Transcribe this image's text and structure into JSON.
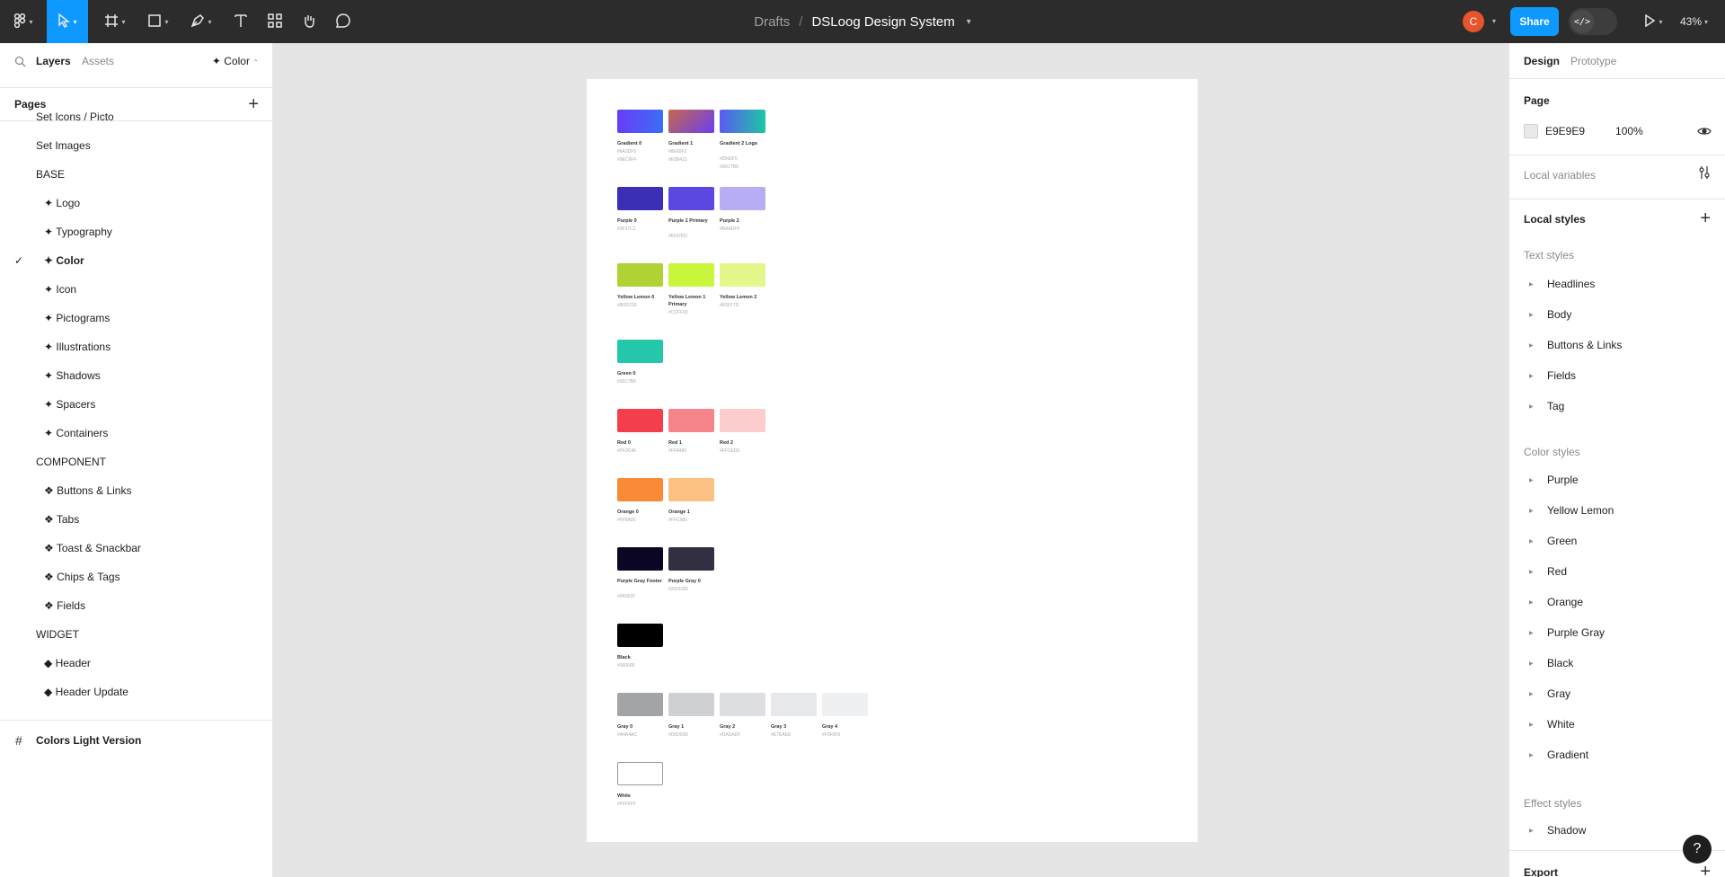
{
  "toolbar": {
    "file_drafts": "Drafts",
    "separator": "/",
    "file_name": "DSLoog Design System",
    "avatar_initial": "C",
    "share_label": "Share",
    "zoom": "43%"
  },
  "left_panel": {
    "tab_layers": "Layers",
    "tab_assets": "Assets",
    "page_selector": "✦ Color",
    "pages_title": "Pages",
    "pages_add": "+",
    "pages": [
      {
        "label": "Set Icons / Picto",
        "indent": 1,
        "current": false
      },
      {
        "label": "Set Images",
        "indent": 1,
        "current": false
      },
      {
        "label": "BASE",
        "indent": 1,
        "current": false
      },
      {
        "label": "✦ Logo",
        "indent": 2,
        "current": false
      },
      {
        "label": "✦ Typography",
        "indent": 2,
        "current": false
      },
      {
        "label": "✦ Color",
        "indent": 2,
        "current": true
      },
      {
        "label": "✦ Icon",
        "indent": 2,
        "current": false
      },
      {
        "label": "✦ Pictograms",
        "indent": 2,
        "current": false
      },
      {
        "label": "✦ Illustrations",
        "indent": 2,
        "current": false
      },
      {
        "label": "✦ Shadows",
        "indent": 2,
        "current": false
      },
      {
        "label": "✦ Spacers",
        "indent": 2,
        "current": false
      },
      {
        "label": "✦ Containers",
        "indent": 2,
        "current": false
      },
      {
        "label": "COMPONENT",
        "indent": 1,
        "current": false
      },
      {
        "label": "❖ Buttons & Links",
        "indent": 2,
        "current": false
      },
      {
        "label": "❖ Tabs",
        "indent": 2,
        "current": false
      },
      {
        "label": "❖ Toast & Snackbar",
        "indent": 2,
        "current": false
      },
      {
        "label": "❖ Chips & Tags",
        "indent": 2,
        "current": false
      },
      {
        "label": "❖ Fields",
        "indent": 2,
        "current": false
      },
      {
        "label": "WIDGET",
        "indent": 1,
        "current": false
      },
      {
        "label": "◆ Header",
        "indent": 2,
        "current": false
      },
      {
        "label": "◆ Header Update",
        "indent": 2,
        "current": false
      }
    ],
    "current_check": "✓",
    "frame_icon": "#",
    "frame_layer": "Colors Light Version"
  },
  "canvas": {
    "groups": [
      {
        "swatches": [
          {
            "name": "Gradient 0",
            "hex": "#6A3DF5\n#9EC6FF",
            "fill": "linear-gradient(90deg,#6a3df5,#3a6ef8)"
          },
          {
            "name": "Gradient 1",
            "hex": "#8E60F3\n#E5B423",
            "fill": "linear-gradient(135deg,#c7694a,#6a3df5)"
          },
          {
            "name": "Gradient 2 Logo",
            "hex": "#5560F5\n#00C7B6",
            "fill": "linear-gradient(90deg,#5b5af0,#1ec6a6)"
          }
        ]
      },
      {
        "swatches": [
          {
            "name": "Purple 0",
            "hex": "#3F37C1",
            "fill": "#3b2fb5"
          },
          {
            "name": "Purple 1 Primary",
            "hex": "#6167ED",
            "fill": "#5a48e0"
          },
          {
            "name": "Purple 2",
            "hex": "#BAADFF",
            "fill": "#b6adf5"
          }
        ]
      },
      {
        "swatches": [
          {
            "name": "Yellow Lemon 0",
            "hex": "#B0DC00",
            "fill": "#afd234"
          },
          {
            "name": "Yellow Lemon 1 Primary",
            "hex": "#CCFF00",
            "fill": "#c9f53c"
          },
          {
            "name": "Yellow Lemon 2",
            "hex": "#E5FF7D",
            "fill": "#e3f78a"
          }
        ]
      },
      {
        "swatches": [
          {
            "name": "Green 0",
            "hex": "#00C7B6",
            "fill": "#24c7aa"
          }
        ]
      },
      {
        "swatches": [
          {
            "name": "Red 0",
            "hex": "#FF3C46",
            "fill": "#f53e4c"
          },
          {
            "name": "Red 1",
            "hex": "#FF8489",
            "fill": "#f5838a"
          },
          {
            "name": "Red 2",
            "hex": "#FFCED0",
            "fill": "#fdcccd"
          }
        ]
      },
      {
        "swatches": [
          {
            "name": "Orange 0",
            "hex": "#FF8A00",
            "fill": "#fb8a36"
          },
          {
            "name": "Orange 1",
            "hex": "#FFC680",
            "fill": "#fcc182"
          }
        ]
      },
      {
        "swatches": [
          {
            "name": "Purple Gray Footer",
            "hex": "#0A001F",
            "fill": "#0b0623"
          },
          {
            "name": "Purple Gray 0",
            "hex": "#2D2D3D",
            "fill": "#312f41"
          }
        ]
      },
      {
        "swatches": [
          {
            "name": "Black",
            "hex": "#000000",
            "fill": "#000000"
          }
        ]
      },
      {
        "swatches": [
          {
            "name": "Gray 0",
            "hex": "#A4A4AC",
            "fill": "#a3a4a8"
          },
          {
            "name": "Gray 1",
            "hex": "#D0D0D6",
            "fill": "#cfd0d4"
          },
          {
            "name": "Gray 2",
            "hex": "#DADADF",
            "fill": "#dcdee2"
          },
          {
            "name": "Gray 3",
            "hex": "#E7EAED",
            "fill": "#e6e8eb"
          },
          {
            "name": "Gray 4",
            "hex": "#F0F0F5",
            "fill": "#eef0f2"
          }
        ]
      },
      {
        "swatches": [
          {
            "name": "White",
            "hex": "#FFFFFF",
            "fill": "#ffffff"
          }
        ]
      }
    ]
  },
  "right_panel": {
    "tab_design": "Design",
    "tab_prototype": "Prototype",
    "page_title": "Page",
    "page_color_hex": "E9E9E9",
    "page_opacity": "100%",
    "local_variables": "Local variables",
    "local_styles": "Local styles",
    "local_styles_add": "+",
    "text_styles_title": "Text styles",
    "text_styles": [
      "Headlines",
      "Body",
      "Buttons & Links",
      "Fields",
      "Tag"
    ],
    "color_styles_title": "Color styles",
    "color_styles": [
      "Purple",
      "Yellow Lemon",
      "Green",
      "Red",
      "Orange",
      "Purple Gray",
      "Black",
      "Gray",
      "White",
      "Gradient"
    ],
    "effect_styles_title": "Effect styles",
    "effect_styles": [
      "Shadow"
    ],
    "export_title": "Export",
    "export_add": "+"
  },
  "help_label": "?"
}
